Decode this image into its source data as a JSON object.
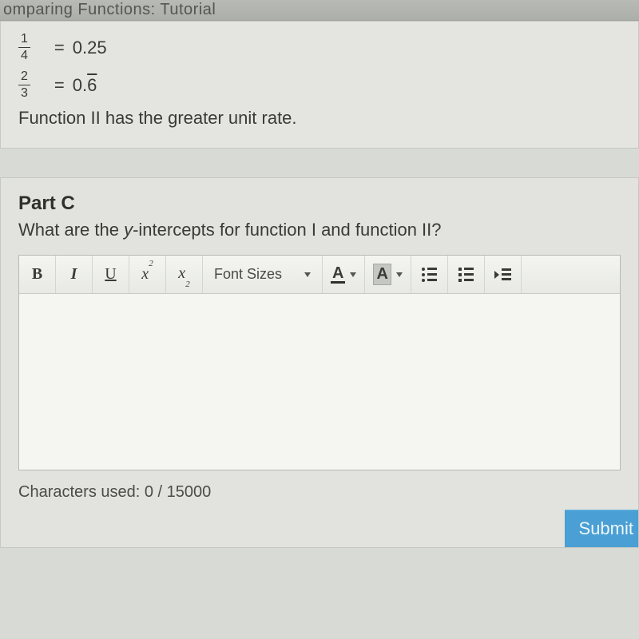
{
  "header": {
    "title": "omparing Functions: Tutorial"
  },
  "answer": {
    "line1": {
      "num": "1",
      "den": "4",
      "eq": "=",
      "val": "0.25"
    },
    "line2": {
      "num": "2",
      "den": "3",
      "eq": "=",
      "val_prefix": "0.",
      "val_repeat": "6"
    },
    "conclusion": "Function II has the greater unit rate."
  },
  "partc": {
    "label": "Part C",
    "question_prefix": "What are the ",
    "question_ital": "y",
    "question_suffix": "-intercepts for function I and function II?"
  },
  "toolbar": {
    "bold": "B",
    "italic": "I",
    "underline": "U",
    "sup_base": "x",
    "sup_exp": "2",
    "sub_base": "x",
    "sub_sub": "2",
    "fontsizes": "Font Sizes",
    "textcolor": "A",
    "highlight": "A"
  },
  "editor": {
    "charcount": "Characters used: 0 / 15000"
  },
  "submit": {
    "label": "Submit"
  }
}
